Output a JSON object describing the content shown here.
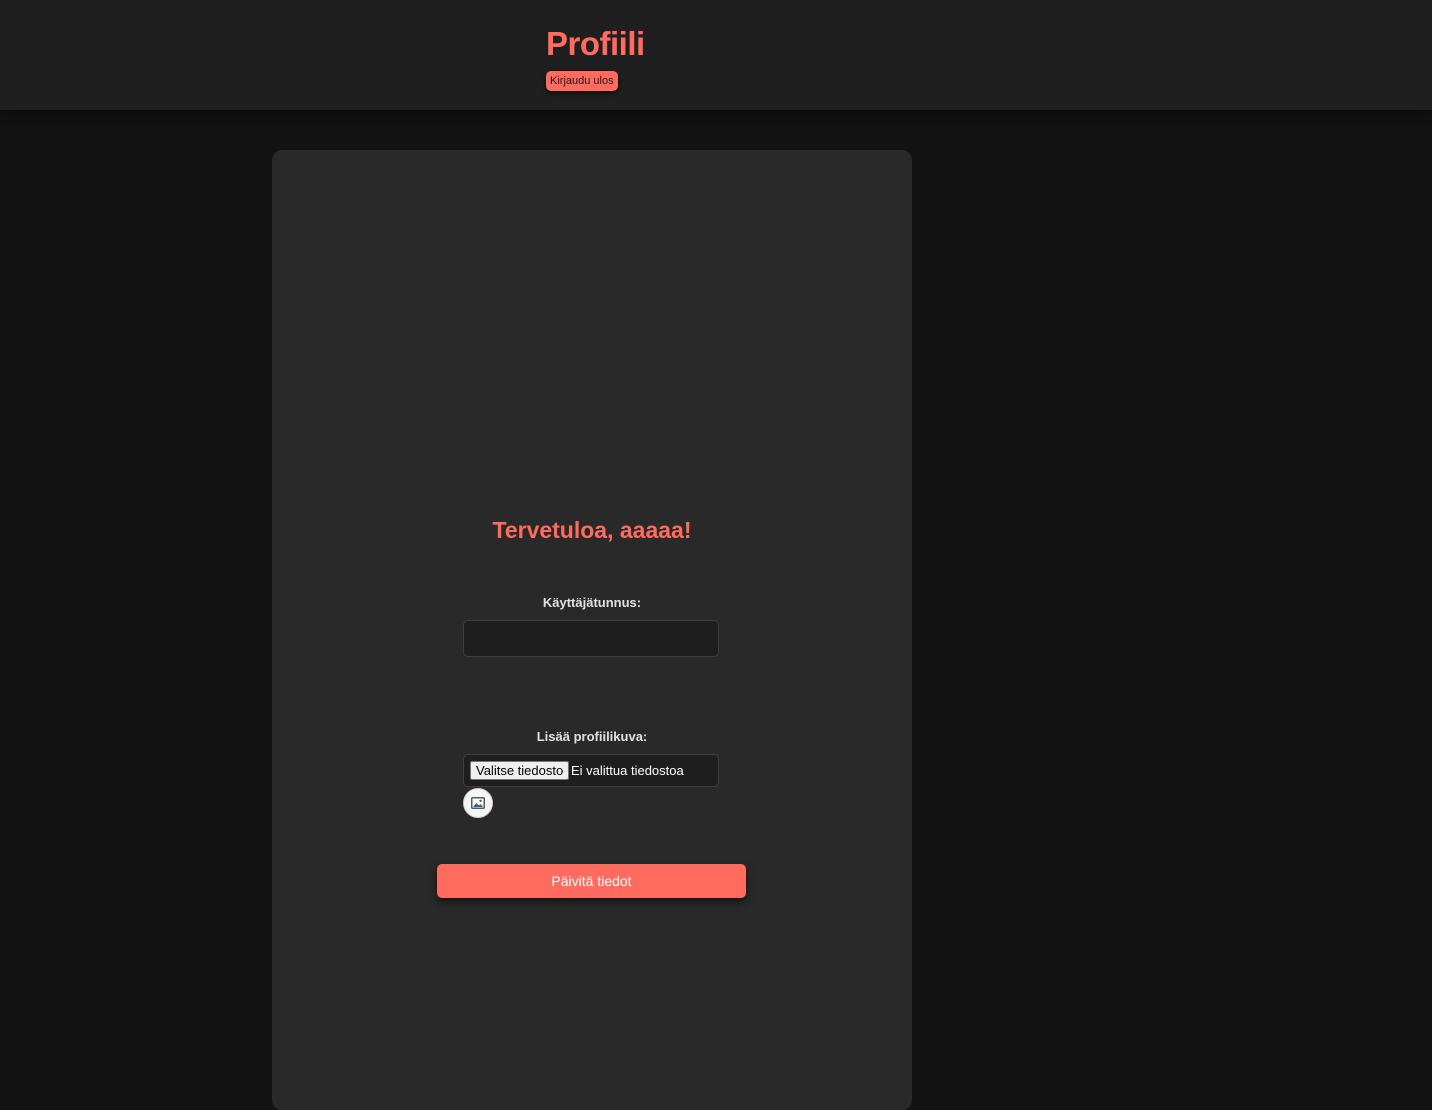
{
  "header": {
    "title": "Profiili",
    "logout_label": "Kirjaudu ulos"
  },
  "profile": {
    "welcome": "Tervetuloa, aaaaa!",
    "username_label": "Käyttäjätunnus:",
    "username_value": "",
    "picture_label": "Lisää profiilikuva:",
    "file_button_label": "Valitse tiedosto",
    "file_status": "Ei valittua tiedostoa",
    "avatar_icon": "image-placeholder-icon",
    "submit_label": "Päivitä tiedot"
  },
  "colors": {
    "accent": "#ff6b5e",
    "background": "#121212",
    "header_bg": "#1f1f1f",
    "card_bg": "#292929"
  }
}
